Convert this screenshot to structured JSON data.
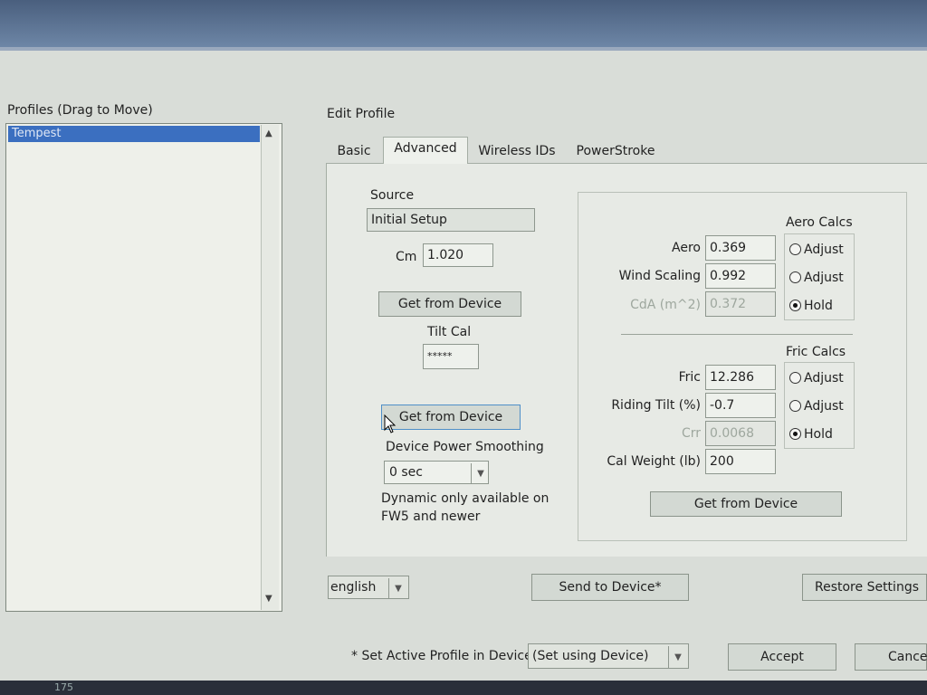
{
  "profiles": {
    "label": "Profiles (Drag to Move)",
    "items": [
      "Tempest"
    ]
  },
  "edit": {
    "label": "Edit Profile",
    "tabs": [
      "Basic",
      "Advanced",
      "Wireless IDs",
      "PowerStroke"
    ]
  },
  "source": {
    "label": "Source",
    "value": "Initial Setup",
    "cm_label": "Cm",
    "cm_value": "1.020",
    "get_button": "Get from Device",
    "tilt_label": "Tilt Cal",
    "tilt_value": "*****",
    "get_button2": "Get from Device",
    "smoothing_label": "Device Power Smoothing",
    "smoothing_value": "0 sec",
    "note_line1": "Dynamic only available on",
    "note_line2": "FW5 and newer"
  },
  "aero": {
    "title": "Aero Calcs",
    "rows": [
      {
        "label": "Aero",
        "value": "0.369",
        "option": "Adjust"
      },
      {
        "label": "Wind Scaling",
        "value": "0.992",
        "option": "Adjust"
      },
      {
        "label": "CdA (m^2)",
        "value": "0.372",
        "option": "Hold"
      }
    ]
  },
  "fric": {
    "title": "Fric Calcs",
    "rows": [
      {
        "label": "Fric",
        "value": "12.286",
        "option": "Adjust"
      },
      {
        "label": "Riding Tilt (%)",
        "value": "-0.7",
        "option": "Adjust"
      },
      {
        "label": "Crr",
        "value": "0.0068",
        "option": "Hold"
      }
    ],
    "cal_label": "Cal Weight (lb)",
    "cal_value": "200",
    "get_button": "Get from Device"
  },
  "footer": {
    "language": "english",
    "send_button": "Send to Device*",
    "restore_button": "Restore Settings",
    "active_note": "* Set Active Profile in Device",
    "active_select": "(Set using Device)",
    "accept_button": "Accept",
    "cancel_button": "Cancel"
  },
  "taskbar": {
    "text": "175"
  }
}
